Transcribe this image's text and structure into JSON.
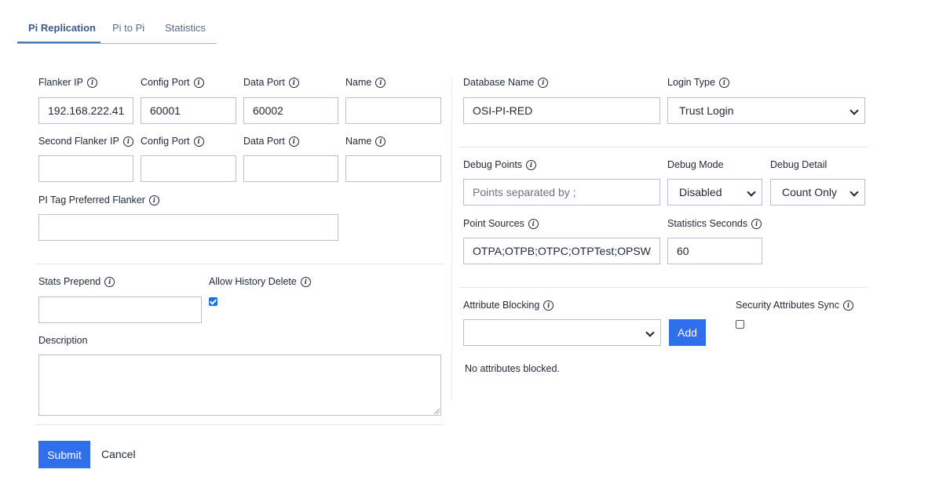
{
  "tabs": [
    {
      "label": "Pi Replication",
      "active": true
    },
    {
      "label": "Pi to Pi",
      "active": false
    },
    {
      "label": "Statistics",
      "active": false
    }
  ],
  "flanker": {
    "ip_label": "Flanker IP",
    "ip_value": "192.168.222.41",
    "config_port_label": "Config Port",
    "config_port_value": "60001",
    "data_port_label": "Data Port",
    "data_port_value": "60002",
    "name_label": "Name",
    "name_value": ""
  },
  "second_flanker": {
    "ip_label": "Second Flanker IP",
    "ip_value": "",
    "config_port_label": "Config Port",
    "config_port_value": "",
    "data_port_label": "Data Port",
    "data_port_value": "",
    "name_label": "Name",
    "name_value": ""
  },
  "pi_tag": {
    "label": "PI Tag Preferred Flanker",
    "value": ""
  },
  "stats_prepend": {
    "label": "Stats Prepend",
    "value": ""
  },
  "allow_history_delete": {
    "label": "Allow History Delete",
    "checked": true
  },
  "description": {
    "label": "Description",
    "value": ""
  },
  "database": {
    "label": "Database Name",
    "value": "OSI-PI-RED"
  },
  "login_type": {
    "label": "Login Type",
    "value": "Trust Login"
  },
  "debug_points": {
    "label": "Debug Points",
    "placeholder": "Points separated by ;"
  },
  "debug_mode": {
    "label": "Debug Mode",
    "value": "Disabled"
  },
  "debug_detail": {
    "label": "Debug Detail",
    "value": "Count Only"
  },
  "point_sources": {
    "label": "Point Sources",
    "value": "OTPA;OTPB;OTPC;OTPTest;OPSWAT"
  },
  "statistics_seconds": {
    "label": "Statistics Seconds",
    "value": "60"
  },
  "attribute_blocking": {
    "label": "Attribute Blocking",
    "value": "",
    "add_label": "Add",
    "status": "No attributes blocked."
  },
  "security_sync": {
    "label": "Security Attributes Sync",
    "checked": false
  },
  "actions": {
    "submit": "Submit",
    "cancel": "Cancel"
  },
  "colors": {
    "primary": "#2f6fec",
    "tab_active": "#3b5a8a",
    "border": "#b8c0cc"
  },
  "icons": {
    "info": "info-circle-icon",
    "chevron": "chevron-down-icon"
  }
}
